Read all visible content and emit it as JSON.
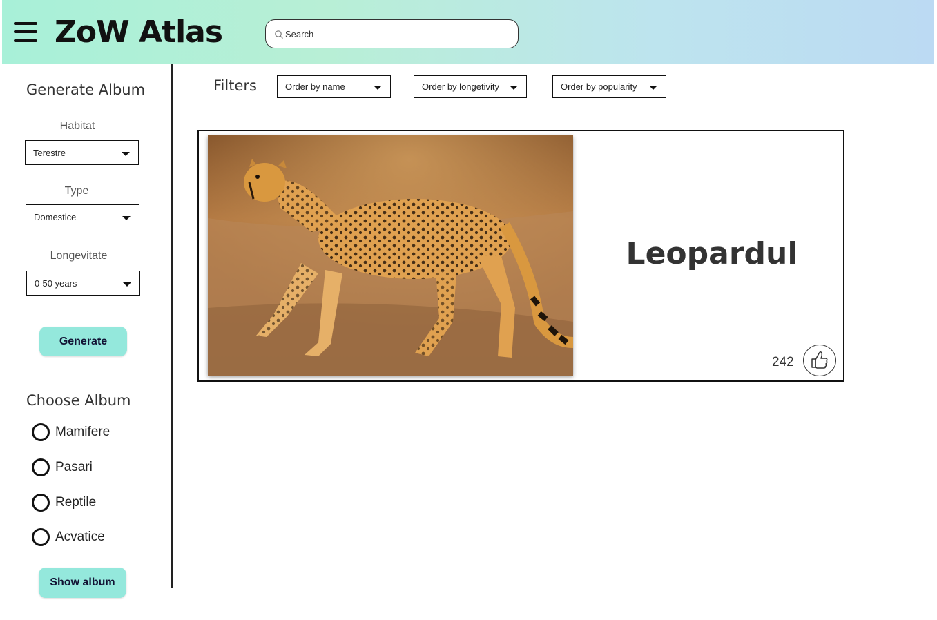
{
  "app": {
    "title": "ZoW Atlas",
    "search_placeholder": "Search"
  },
  "sidebar": {
    "generate_heading": "Generate Album",
    "fields": [
      {
        "label": "Habitat",
        "value": "Terestre"
      },
      {
        "label": "Type",
        "value": "Domestice"
      },
      {
        "label": "Longevitate",
        "value": "0-50 years"
      }
    ],
    "generate_button": "Generate",
    "choose_heading": "Choose Album",
    "albums": [
      "Mamifere",
      "Pasari",
      "Reptile",
      "Acvatice"
    ],
    "show_button": "Show album"
  },
  "filters": {
    "label": "Filters",
    "options": [
      "Order by name",
      "Order by longetivity",
      "Order by popularity"
    ]
  },
  "card": {
    "name": "Leopardul",
    "likes": "242",
    "image": "cheetah-photo",
    "like_icon": "thumbs-up-icon"
  },
  "colors": {
    "accent": "#94e8dc",
    "header_start": "#a8f0d8",
    "header_end": "#bcdaf3"
  }
}
